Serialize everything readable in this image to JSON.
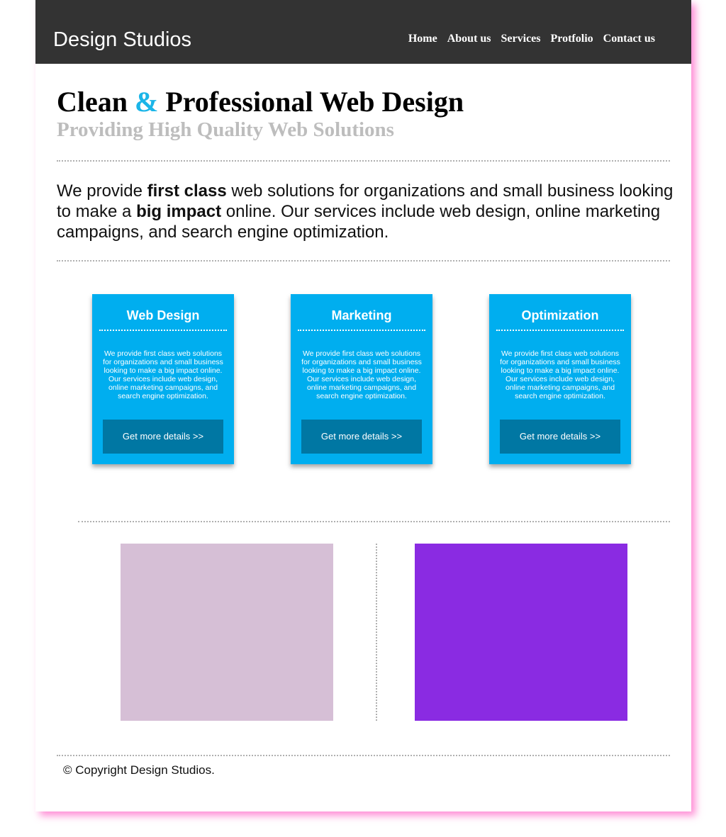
{
  "header": {
    "logo": "Design Studios",
    "nav": [
      "Home",
      "About us",
      "Services",
      "Protfolio",
      "Contact us"
    ]
  },
  "hero": {
    "title_part1": "Clean",
    "title_amp": "&",
    "title_part2": "Professional Web Design",
    "subtitle": "Providing High Quality Web Solutions"
  },
  "intro": {
    "segments": [
      "We provide ",
      "first class",
      " web solutions for organizations and small business looking to make a ",
      "big impact",
      " online. Our services include web design, online marketing campaigns, and search engine optimization."
    ]
  },
  "cards": [
    {
      "title": "Web Design",
      "text": "We provide first class web solutions for organizations and small business looking to make a big impact online. Our services include web design, online marketing campaigns, and search engine optimization.",
      "button": "Get more details >>"
    },
    {
      "title": "Marketing",
      "text": "We provide first class web solutions for organizations and small business looking to make a big impact online. Our services include web design, online marketing campaigns, and search engine optimization.",
      "button": "Get more details >>"
    },
    {
      "title": "Optimization",
      "text": "We provide first class web solutions for organizations and small business looking to make a big impact online. Our services include web design, online marketing campaigns, and search engine optimization.",
      "button": "Get more details >>"
    }
  ],
  "colors": {
    "header_bg": "#333333",
    "accent": "#1bb5e8",
    "card_bg": "#00aeef",
    "card_button_bg": "#0077a3",
    "image_left": "#d6bfd6",
    "image_right": "#8a2be2",
    "page_shadow": "#ff69c8"
  },
  "footer": {
    "copyright": "© Copyright Design Studios."
  }
}
